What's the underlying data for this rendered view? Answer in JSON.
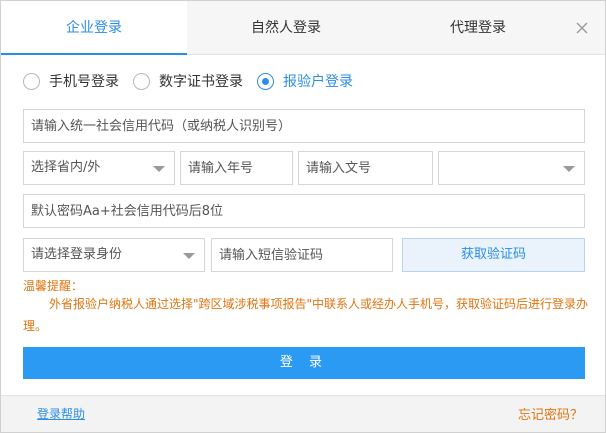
{
  "tabs": [
    {
      "label": "企业登录",
      "active": true
    },
    {
      "label": "自然人登录",
      "active": false
    },
    {
      "label": "代理登录",
      "active": false
    }
  ],
  "login_methods": [
    {
      "label": "手机号登录",
      "checked": false
    },
    {
      "label": "数字证书登录",
      "checked": false
    },
    {
      "label": "报验户登录",
      "checked": true
    }
  ],
  "form": {
    "credit_code_placeholder": "请输入统一社会信用代码（或纳税人识别号）",
    "province_select": "选择省内/外",
    "year_placeholder": "请输入年号",
    "doc_placeholder": "请输入文号",
    "extra_select": "",
    "password_placeholder": "默认密码Aa+社会信用代码后8位",
    "role_select": "请选择登录身份",
    "sms_placeholder": "请输入短信验证码",
    "get_code_label": "获取验证码"
  },
  "tip": {
    "title": "温馨提醒：",
    "body": "外省报验户纳税人通过选择\"跨区域涉税事项报告\"中联系人或经办人手机号，获取验证码后进行登录办理。"
  },
  "login_label": "登 录",
  "footer": {
    "help_label": "登录帮助",
    "forgot_label": "忘记密码？"
  },
  "colors": {
    "accent": "#2b8ee8",
    "warning": "#e2740f",
    "login_button": "#2b9af3"
  },
  "icons": {
    "close": "close-icon",
    "dropdown": "chevron-down-icon"
  }
}
